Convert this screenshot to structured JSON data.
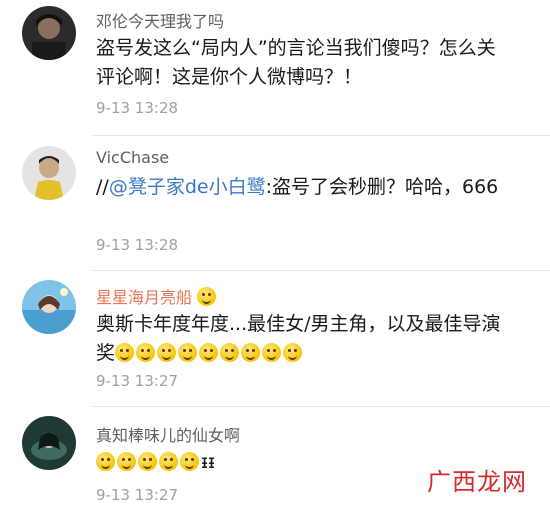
{
  "comments": [
    {
      "username": "邓伦今天理我了吗",
      "text": "盗号发这么“局内人”的言论当我们傻吗？怎么关评论啊！这是你个人微博吗？！",
      "time": "9-13 13:28"
    },
    {
      "username": "VicChase",
      "prefix": "//",
      "mention": "@凳子家de小白鹭",
      "text": ":盗号了会秒删？哈哈，666",
      "time": "9-13 13:28"
    },
    {
      "username": "星星海月亮船",
      "badge_icon": "heart-eyes-emoji-icon",
      "text": "奥斯卡年度年度...最佳女/男主角，以及最佳导演奖",
      "emoji_count": 9,
      "time": "9-13 13:27"
    },
    {
      "username": "真知棒味儿的仙女啊",
      "emoji_count": 5,
      "suffix": "ᵻᵻ",
      "time": "9-13 13:27"
    }
  ],
  "watermark": "广西龙网",
  "colors": {
    "vip_name": "#eb7350",
    "mention": "#3c78c8",
    "time": "#a0a0a0",
    "watermark": "#d62b2b"
  }
}
